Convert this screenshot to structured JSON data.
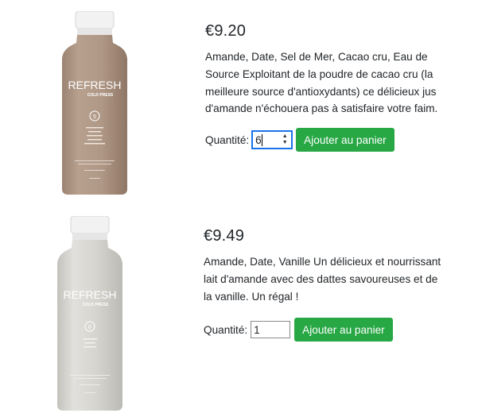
{
  "products": [
    {
      "price": "€9.20",
      "description": "Amande, Date, Sel de Mer, Cacao cru, Eau de Source Exploitant de la poudre de cacao cru (la meilleure source d'antioxydants) ce délicieux jus d'amande n'échouera pas à satisfaire votre faim.",
      "quantity_label": "Quantité:",
      "quantity_value": "6",
      "add_label": "Ajouter au panier",
      "bottle_color": "#b09886",
      "brand": "REFRESH",
      "subbrand": "COLD PRESS",
      "number": "5"
    },
    {
      "price": "€9.49",
      "description": "Amande, Date, Vanille Un délicieux et nourrissant lait d'amande avec des dattes savoureuses et de la vanille. Un régal !",
      "quantity_label": "Quantité:",
      "quantity_value": "1",
      "add_label": "Ajouter au panier",
      "bottle_color": "#d6d4cf",
      "brand": "REFRESH",
      "subbrand": "COLD PRESS",
      "number": "6"
    }
  ],
  "colors": {
    "button": "#28a745",
    "focus": "#1a73e8"
  }
}
